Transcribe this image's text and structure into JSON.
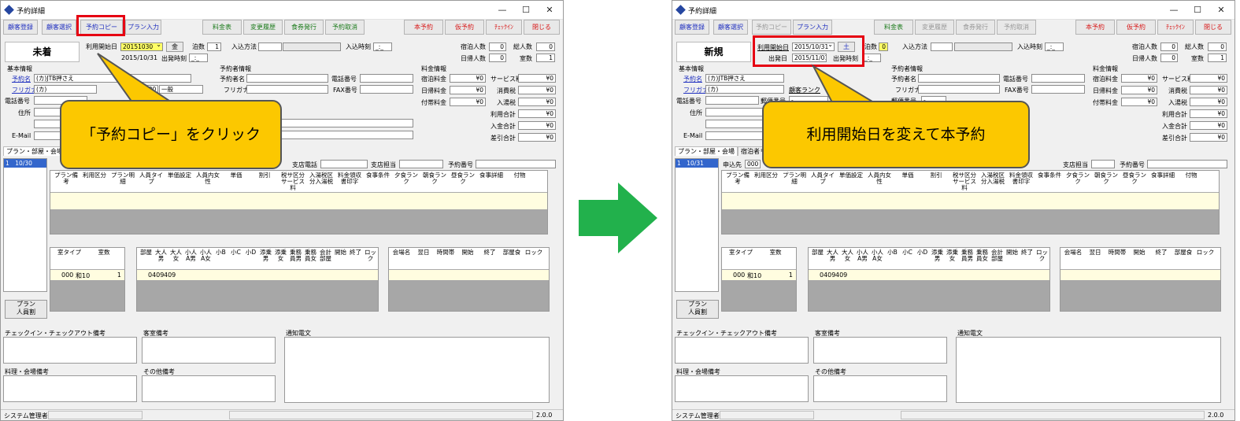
{
  "window": {
    "title": "予約詳細",
    "minimize": "—",
    "maximize": "☐",
    "close": "✕"
  },
  "toolbar": {
    "customer_register": "顧客登録",
    "customer_select": "顧客選択",
    "reservation_copy": "予約コピー",
    "plan_input": "プラン入力",
    "price_table": "料金表",
    "change_history": "変更履歴",
    "meal_ticket": "食券発行",
    "reservation_cancel": "予約取消",
    "book": "本予約",
    "tentative_book": "仮予約",
    "checkin": "ﾁｪｯｸｲﾝ",
    "close_btn": "閉じる"
  },
  "labels": {
    "start_date": "利用開始日",
    "departure_date": "出発日",
    "departure_time": "出発時刻",
    "nights": "泊数",
    "entry_method": "入込方法",
    "entry_time": "入込時刻",
    "stay_count": "宿泊人数",
    "day_count": "日帰人数",
    "total_count": "総人数",
    "room_count": "室数",
    "basic_info": "基本情報",
    "reserver_name": "予約名",
    "furigana": "フリガナ",
    "phone": "電話番号",
    "postal": "郵便番号",
    "address": "住所",
    "email": "E-Mail",
    "reserver_info": "予約者情報",
    "reserver": "予約者名",
    "fax": "FAX番号",
    "price_info": "料金情報",
    "stay_fee": "宿泊料金",
    "day_fee": "日帰料金",
    "extra_fee": "付帯料金",
    "service_fee": "サービス料",
    "consumption_tax": "消費税",
    "bath_tax": "入湯税",
    "use_total": "利用合計",
    "paid_total": "入金合計",
    "balance": "差引合計",
    "customer_rank": "顧客ランク",
    "branch_phone": "支店電話",
    "branch_staff": "支店担当",
    "reservation_no": "予約番号",
    "applicant": "申込先",
    "plan_btn": "プラン\n人員割",
    "memo_checkio": "チェックイン・チェックアウト備考",
    "memo_room": "客室備考",
    "memo_notice": "通知電文",
    "memo_food": "料理・会場備考",
    "memo_other": "その他備考",
    "setting": "設定"
  },
  "tabs": {
    "plan_room": "プラン・部屋・会場",
    "stay_list": "宿泊者リスト"
  },
  "plan_grid_headers": [
    "プラン備考",
    "利用区分",
    "プラン明細",
    "人員タイプ",
    "単価設定",
    "人員内女性",
    "単価",
    "割引",
    "税サ区分サービス料",
    "入湯税区分入湯税",
    "料金領収書印字",
    "食事条件",
    "夕食ランク",
    "朝食ランク",
    "昼食ランク",
    "食事詳細",
    "付物"
  ],
  "room_type_headers": [
    "室タイプ",
    "室数"
  ],
  "room_headers": [
    "部屋",
    "大人男",
    "大人女",
    "小人A男",
    "小人A女",
    "小B",
    "小C",
    "小D",
    "添乗男",
    "添乗女",
    "乗務員男",
    "乗務員女",
    "会計部屋",
    "開始",
    "終了",
    "ロック"
  ],
  "venue_headers": [
    "会場名",
    "翌日",
    "時間帯",
    "開始",
    "終了",
    "部屋食",
    "ロック"
  ],
  "left": {
    "status": "未着",
    "start_date": "20151030",
    "day_btn": "金",
    "nights": "1",
    "departure": "2015/10/31",
    "entry_time": "_:_",
    "departure_time": "_:_",
    "stay_count": "0",
    "day_count": "0",
    "total_count": "0",
    "room_count": "1",
    "reserver_name": "(カ)JTB押さえ",
    "furigana": "(カ)",
    "customer_rank_code": "000",
    "customer_rank": "一般",
    "yen": "¥0",
    "list_item": "1　10/30",
    "room_type_row": {
      "code": "000",
      "name": "和10",
      "count": "1"
    },
    "room_row": {
      "code": "0409",
      "name": "409"
    }
  },
  "right": {
    "status": "新規",
    "start_date": "2015/10/31",
    "day_btn": "土",
    "nights": "0",
    "departure": "2015/11/01",
    "entry_time": "_:_",
    "departure_time": "_:_",
    "stay_count": "0",
    "day_count": "0",
    "total_count": "0",
    "room_count": "1",
    "reserver_name": "(カ)JTB押さえ",
    "furigana": "(カ)",
    "yen": "¥0",
    "list_item": "1　10/31",
    "applicant_code": "000",
    "postal": "-",
    "room_type_row": {
      "code": "000",
      "name": "和10",
      "count": "1"
    },
    "room_row": {
      "code": "0409",
      "name": "409"
    }
  },
  "status_bar": {
    "user": "システム管理者",
    "version": "2.0.0"
  },
  "annotations": {
    "left_callout": "「予約コピー」をクリック",
    "right_callout": "利用開始日を変えて本予約"
  },
  "colors": {
    "toolbar_blue": "#1f2fbf",
    "toolbar_green": "#1a7a1a",
    "toolbar_red": "#d81818",
    "callout_yellow": "#fcc800",
    "highlight_red": "#e60012",
    "arrow_green": "#22b14c"
  }
}
